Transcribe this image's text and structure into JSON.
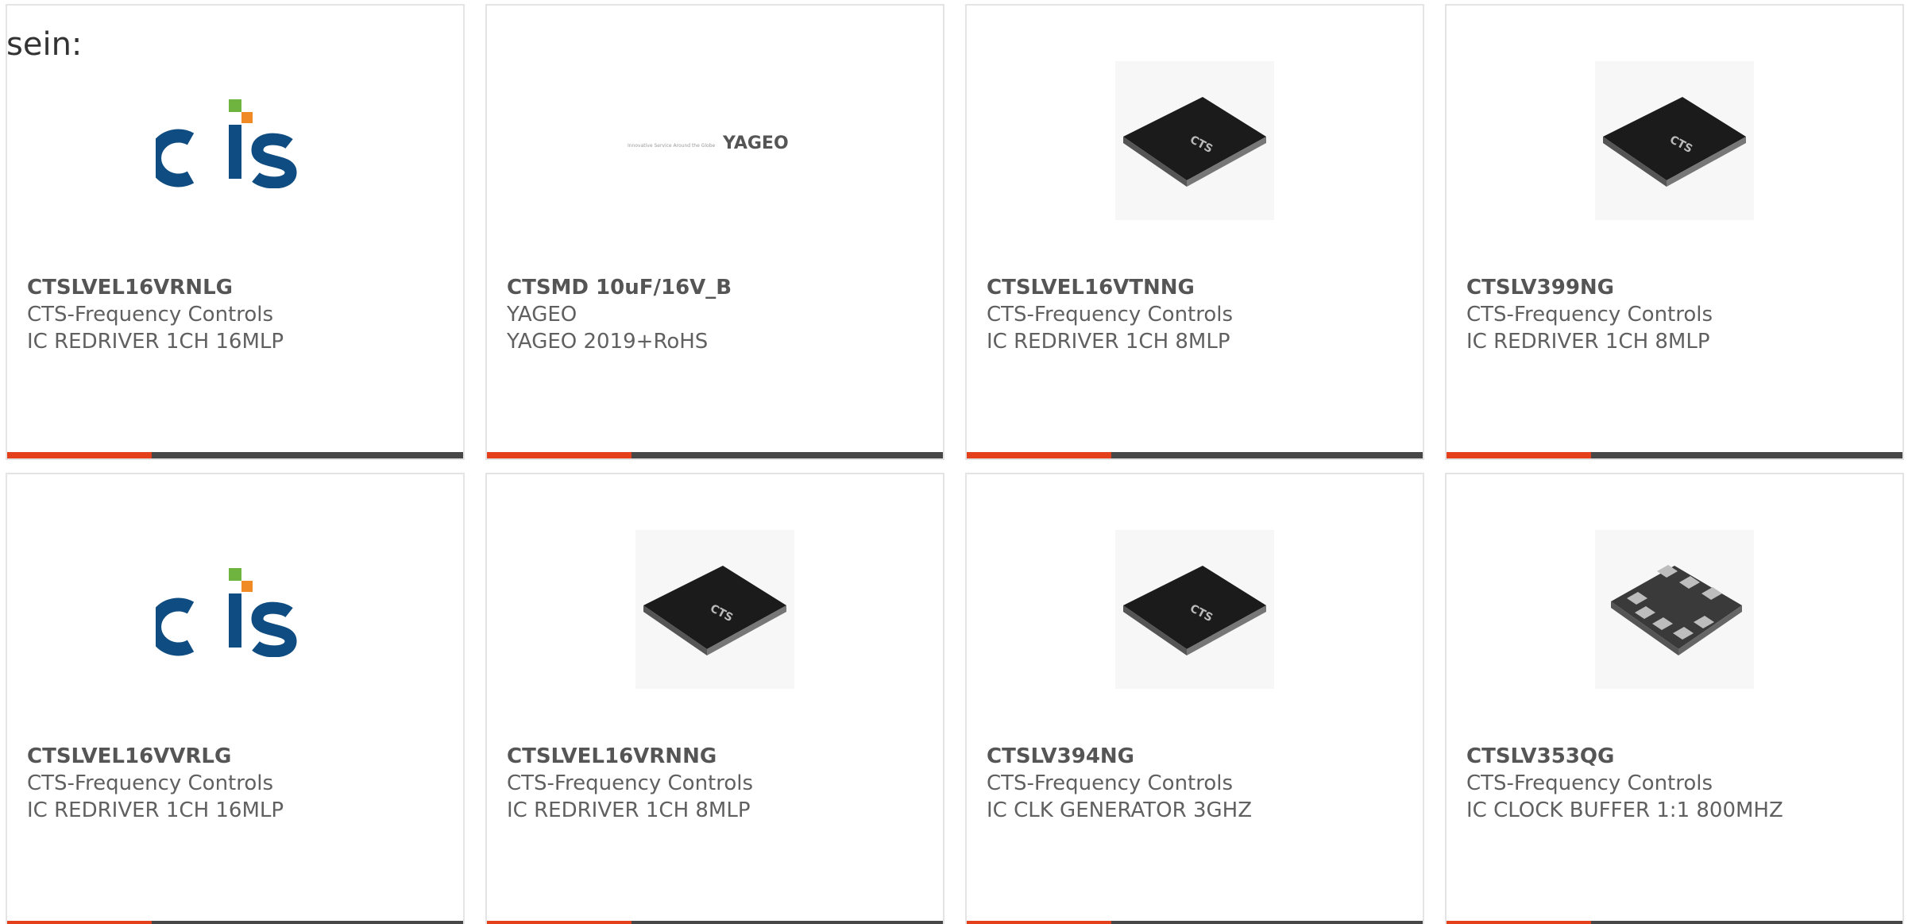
{
  "intro_text": "sein:",
  "colors": {
    "accent": "#e5401c",
    "bar": "#474747",
    "cts_blue": "#0f4c81",
    "cts_green": "#6fb43f",
    "cts_orange": "#f08a24"
  },
  "products": [
    {
      "part": "CTSLVEL16VRNLG",
      "manufacturer": "CTS-Frequency Controls",
      "description": "IC REDRIVER 1CH 16MLP",
      "image": "cts-logo"
    },
    {
      "part": "CTSMD 10uF/16V_B",
      "manufacturer": "YAGEO",
      "description": "YAGEO 2019+RoHS",
      "image": "yageo-logo",
      "logo_text": "YAGEO",
      "logo_tagline": "Innovative Service Around the Globe"
    },
    {
      "part": "CTSLVEL16VTNNG",
      "manufacturer": "CTS-Frequency Controls",
      "description": "IC REDRIVER 1CH 8MLP",
      "image": "chip-icon"
    },
    {
      "part": "CTSLV399NG",
      "manufacturer": "CTS-Frequency Controls",
      "description": "IC REDRIVER 1CH 8MLP",
      "image": "chip-icon"
    },
    {
      "part": "CTSLVEL16VVRLG",
      "manufacturer": "CTS-Frequency Controls",
      "description": "IC REDRIVER 1CH 16MLP",
      "image": "cts-logo"
    },
    {
      "part": "CTSLVEL16VRNNG",
      "manufacturer": "CTS-Frequency Controls",
      "description": "IC REDRIVER 1CH 8MLP",
      "image": "chip-icon"
    },
    {
      "part": "CTSLV394NG",
      "manufacturer": "CTS-Frequency Controls",
      "description": "IC CLK GENERATOR 3GHZ",
      "image": "chip-icon"
    },
    {
      "part": "CTSLV353QG",
      "manufacturer": "CTS-Frequency Controls",
      "description": "IC CLOCK BUFFER 1:1 800MHZ",
      "image": "qfn-chip-icon"
    }
  ]
}
